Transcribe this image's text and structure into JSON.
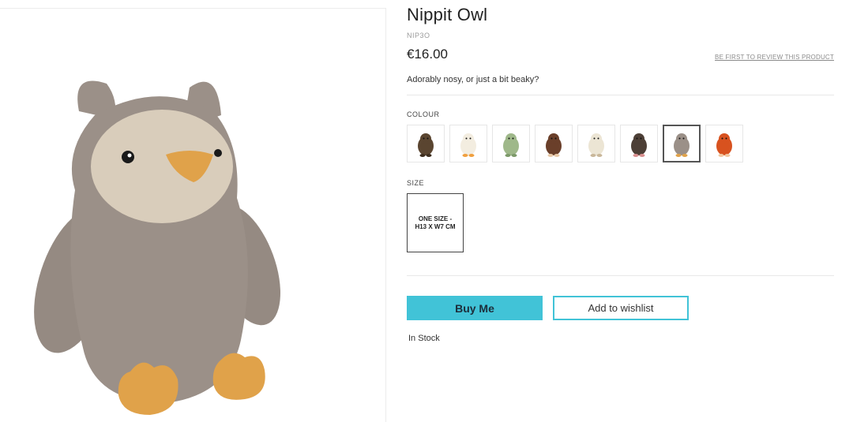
{
  "product": {
    "title": "Nippit Owl",
    "sku": "NIP3O",
    "price": "€16.00",
    "review_link": "BE FIRST TO REVIEW THIS PRODUCT",
    "tagline": "Adorably nosy, or just a bit beaky?"
  },
  "colour": {
    "label": "COLOUR",
    "swatches": [
      {
        "name": "beaver",
        "color": "#5a4530",
        "accent": "#3e2e1f"
      },
      {
        "name": "duck",
        "color": "#f3ede0",
        "accent": "#f0a040"
      },
      {
        "name": "frog",
        "color": "#9fb88a",
        "accent": "#7d9a6a"
      },
      {
        "name": "hedgehog",
        "color": "#6a3f2a",
        "accent": "#e8c9a8"
      },
      {
        "name": "sheep",
        "color": "#ece5d4",
        "accent": "#c9b79a"
      },
      {
        "name": "mole",
        "color": "#4d3f36",
        "accent": "#d88f8f"
      },
      {
        "name": "owl",
        "color": "#9b9088",
        "accent": "#e0a24a",
        "selected": true
      },
      {
        "name": "squirrel",
        "color": "#d8521f",
        "accent": "#f2c7a0"
      }
    ]
  },
  "size": {
    "label": "SIZE",
    "option": "ONE SIZE - H13 X W7 CM"
  },
  "actions": {
    "buy_label": "Buy Me",
    "wishlist_label": "Add to wishlist"
  },
  "stock_status": "In Stock",
  "colors": {
    "accent": "#41c3d7",
    "owl_body": "#9b9088",
    "owl_face": "#d9cdbb",
    "owl_feet": "#e0a24a"
  }
}
